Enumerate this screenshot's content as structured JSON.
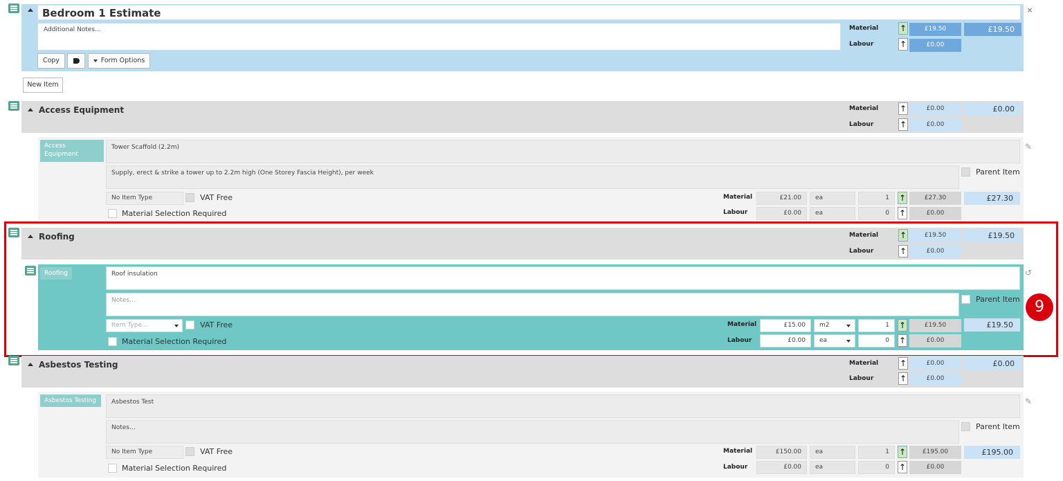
{
  "estimate": {
    "title": "Bedroom 1 Estimate",
    "notes_placeholder": "Additional Notes...",
    "material_label": "Material",
    "labour_label": "Labour",
    "material_value": "£19.50",
    "labour_value": "£0.00",
    "total": "£19.50",
    "copy_button": "Copy",
    "form_options_button": "Form Options",
    "close_icon": "close-icon",
    "tag_icon": "tag-icon"
  },
  "new_item_button": "New Item",
  "sections": {
    "access": {
      "title": "Access Equipment",
      "material_label": "Material",
      "labour_label": "Labour",
      "material_value": "£0.00",
      "labour_value": "£0.00",
      "total": "£0.00",
      "item": {
        "tag": "Access Equipment",
        "name": "Tower Scaffold (2.2m)",
        "description": "Supply, erect & strike a tower up to 2.2m high (One Storey Fascia Height), per week",
        "parent_item_label": "Parent Item",
        "item_type": "No Item Type",
        "vat_free_label": "VAT Free",
        "material_selection_label": "Material Selection Required",
        "material_label": "Material",
        "labour_label": "Labour",
        "material_rate": "£21.00",
        "material_unit": "ea",
        "material_qty": "1",
        "material_value": "£27.30",
        "labour_rate": "£0.00",
        "labour_unit": "ea",
        "labour_qty": "0",
        "labour_value": "£0.00",
        "total": "£27.30"
      }
    },
    "roofing": {
      "title": "Roofing",
      "material_label": "Material",
      "labour_label": "Labour",
      "material_value": "£19.50",
      "labour_value": "£0.00",
      "total": "£19.50",
      "badge": "9",
      "item": {
        "tag": "Roofing",
        "name": "Roof insulation",
        "notes_placeholder": "Notes...",
        "parent_item_label": "Parent Item",
        "item_type_placeholder": "Item Type...",
        "vat_free_label": "VAT Free",
        "material_selection_label": "Material Selection Required",
        "material_label": "Material",
        "labour_label": "Labour",
        "material_rate": "£15.00",
        "material_unit": "m2",
        "material_qty": "1",
        "material_value": "£19.50",
        "labour_rate": "£0.00",
        "labour_unit": "ea",
        "labour_qty": "0",
        "labour_value": "£0.00",
        "total": "£19.50"
      }
    },
    "asbestos": {
      "title": "Asbestos Testing",
      "material_label": "Material",
      "labour_label": "Labour",
      "material_value": "£0.00",
      "labour_value": "£0.00",
      "total": "£0.00",
      "item": {
        "tag": "Asbestos Testing",
        "name": "Asbestos Test",
        "notes": "Notes...",
        "parent_item_label": "Parent Item",
        "item_type": "No Item Type",
        "vat_free_label": "VAT Free",
        "material_selection_label": "Material Selection Required",
        "material_label": "Material",
        "labour_label": "Labour",
        "material_rate": "£150.00",
        "material_unit": "ea",
        "material_qty": "1",
        "material_value": "£195.00",
        "labour_rate": "£0.00",
        "labour_unit": "ea",
        "labour_qty": "0",
        "labour_value": "£0.00",
        "total": "£195.00"
      }
    }
  },
  "colors": {
    "estimate_bg": "#b9dcf1",
    "section_bg": "#dddddd",
    "teal": "#6fc8c6",
    "price_blue": "#6fa8dc",
    "highlight_red": "#d9000d"
  }
}
